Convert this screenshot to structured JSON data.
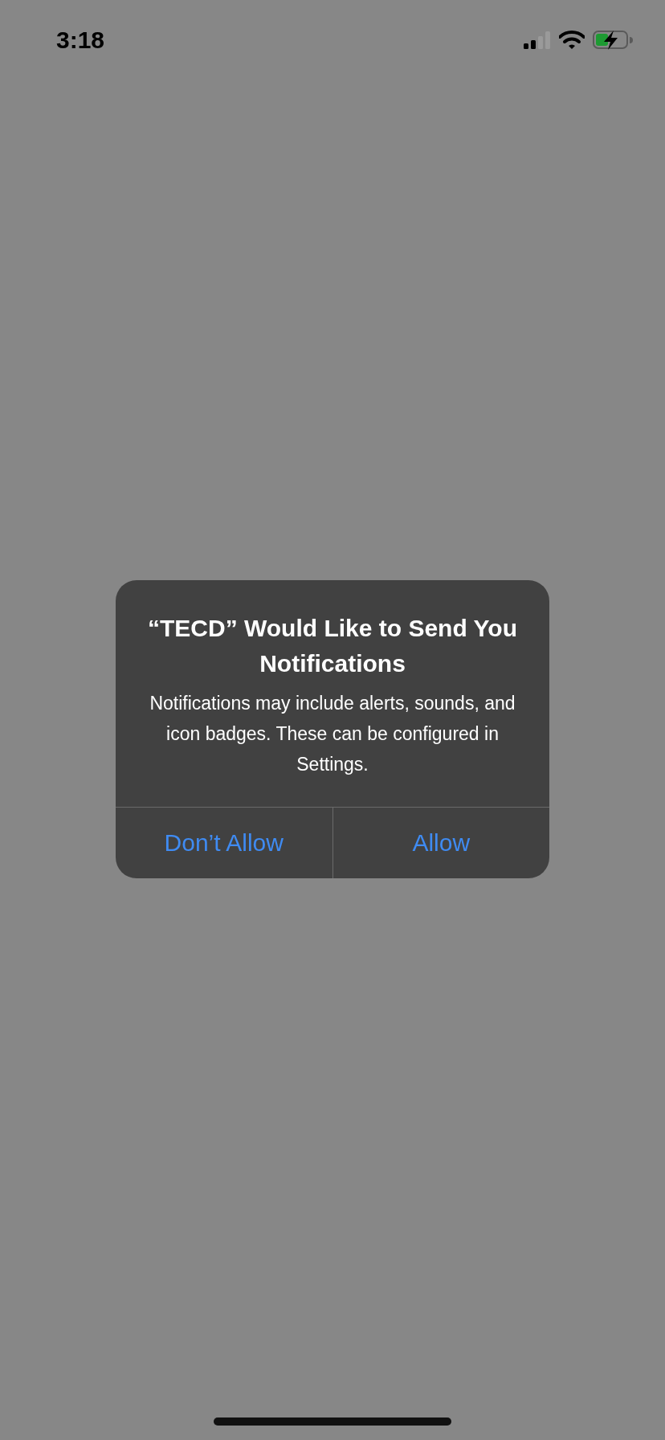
{
  "status_bar": {
    "time": "3:18"
  },
  "alert": {
    "title": "“TECD” Would Like to Send You Notifications",
    "message": "Notifications may include alerts, sounds, and icon badges. These can be configured in Settings.",
    "buttons": [
      {
        "label": "Don’t Allow"
      },
      {
        "label": "Allow"
      }
    ]
  }
}
